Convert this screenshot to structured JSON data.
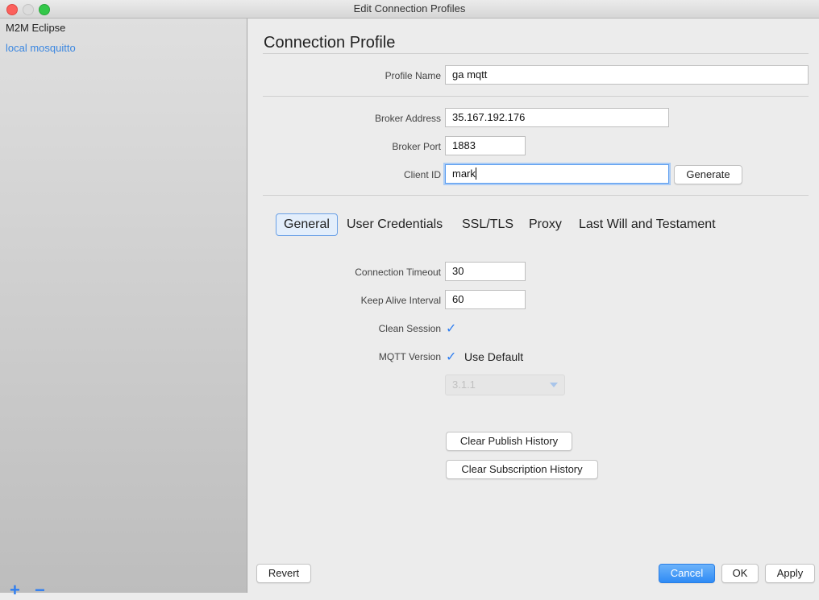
{
  "window": {
    "title": "Edit Connection Profiles"
  },
  "sidebar": {
    "items": [
      {
        "label": "M2M Eclipse"
      },
      {
        "label": "local mosquitto"
      }
    ],
    "add_symbol": "+",
    "remove_symbol": "−"
  },
  "profile": {
    "heading": "Connection Profile",
    "profile_name_label": "Profile Name",
    "profile_name_value": "ga mqtt",
    "broker_address_label": "Broker Address",
    "broker_address_value": "35.167.192.176",
    "broker_port_label": "Broker Port",
    "broker_port_value": "1883",
    "client_id_label": "Client ID",
    "client_id_value": "mark",
    "generate_label": "Generate"
  },
  "tabs": [
    {
      "label": "General"
    },
    {
      "label": "User Credentials"
    },
    {
      "label": "SSL/TLS"
    },
    {
      "label": "Proxy"
    },
    {
      "label": "Last Will and Testament"
    }
  ],
  "general": {
    "connection_timeout_label": "Connection Timeout",
    "connection_timeout_value": "30",
    "keep_alive_label": "Keep Alive Interval",
    "keep_alive_value": "60",
    "clean_session_label": "Clean Session",
    "mqtt_version_label": "MQTT Version",
    "use_default_label": "Use Default",
    "version_value": "3.1.1",
    "clear_publish_label": "Clear Publish History",
    "clear_subscription_label": "Clear Subscription History"
  },
  "footer": {
    "revert_label": "Revert",
    "cancel_label": "Cancel",
    "ok_label": "OK",
    "apply_label": "Apply"
  },
  "colors": {
    "accent": "#2f7ef0",
    "selected_item": "#3b87e0"
  }
}
